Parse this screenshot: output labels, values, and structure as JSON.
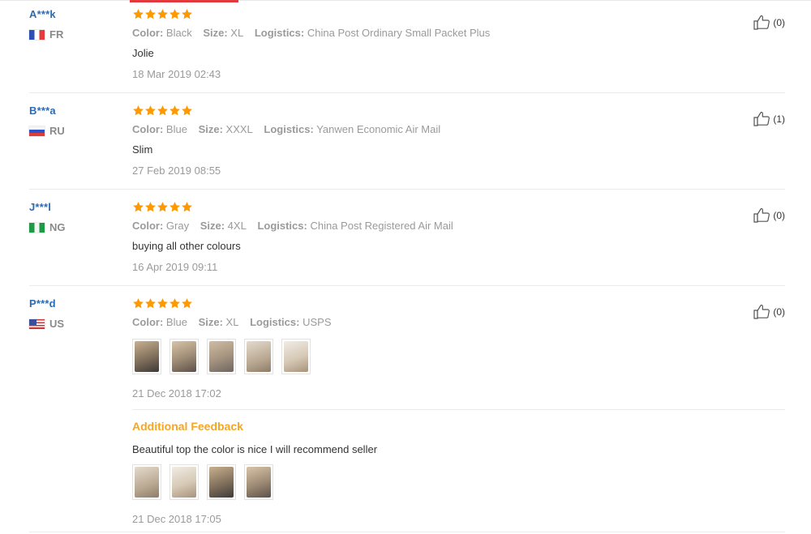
{
  "labels": {
    "color": "Color:",
    "size": "Size:",
    "logistics": "Logistics:"
  },
  "colors": {
    "username": "#2a6bb6",
    "star": "#ff9900",
    "additional_feedback": "#f5a623",
    "accent": "#e4393c"
  },
  "reviews": [
    {
      "user": "A***k",
      "country": "FR",
      "rating": 5,
      "color": "Black",
      "size": "XL",
      "logistics": "China Post Ordinary Small Packet Plus",
      "text": "Jolie",
      "date": "18 Mar 2019 02:43",
      "likes": "(0)"
    },
    {
      "user": "B***a",
      "country": "RU",
      "rating": 5,
      "color": "Blue",
      "size": "XXXL",
      "logistics": "Yanwen Economic Air Mail",
      "text": "Slim",
      "date": "27 Feb 2019 08:55",
      "likes": "(1)"
    },
    {
      "user": "J***l",
      "country": "NG",
      "rating": 5,
      "color": "Gray",
      "size": "4XL",
      "logistics": "China Post Registered Air Mail",
      "text": "buying all other colours",
      "date": "16 Apr 2019 09:11",
      "likes": "(0)"
    },
    {
      "user": "P***d",
      "country": "US",
      "rating": 5,
      "color": "Blue",
      "size": "XL",
      "logistics": "USPS",
      "date": "21 Dec 2018 17:02",
      "likes": "(0)",
      "photo_count": 5,
      "additional": {
        "title": "Additional Feedback",
        "text": "Beautiful top the color is nice I will recommend seller",
        "date": "21 Dec 2018 17:05",
        "photo_count": 4
      }
    }
  ]
}
